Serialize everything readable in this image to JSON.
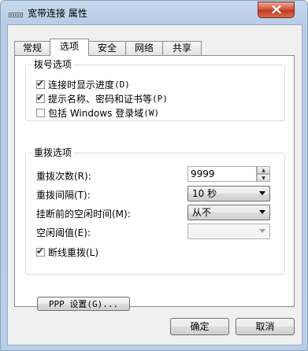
{
  "window": {
    "title": "宽带连接 属性",
    "icon": "network-connection-icon",
    "close_icon": "close-icon"
  },
  "tabs": [
    {
      "label": "常规",
      "active": false
    },
    {
      "label": "选项",
      "active": true
    },
    {
      "label": "安全",
      "active": false
    },
    {
      "label": "网络",
      "active": false
    },
    {
      "label": "共享",
      "active": false
    }
  ],
  "dialing_options": {
    "label": "拨号选项",
    "items": [
      {
        "label": "连接时显示进度",
        "shortcut": "(D)",
        "checked": true
      },
      {
        "label": "提示名称、密码和证书等",
        "shortcut": "(P)",
        "checked": true
      },
      {
        "label": "包括 Windows 登录域",
        "shortcut": "(W)",
        "checked": false
      }
    ]
  },
  "redial_options": {
    "label": "重拨选项",
    "redial_attempts_label": "重拨次数(R):",
    "redial_attempts_value": "9999",
    "redial_interval_label": "重拨间隔(T):",
    "redial_interval_value": "10 秒",
    "idle_hangup_label": "挂断前的空闲时间(M):",
    "idle_hangup_value": "从不",
    "idle_threshold_label": "空闲阈值(E):",
    "idle_threshold_value": "",
    "redial_if_dropped_label": "断线重拨(L)",
    "redial_if_dropped_checked": true
  },
  "ppp_button": "PPP 设置(G)...",
  "buttons": {
    "ok": "确定",
    "cancel": "取消"
  }
}
